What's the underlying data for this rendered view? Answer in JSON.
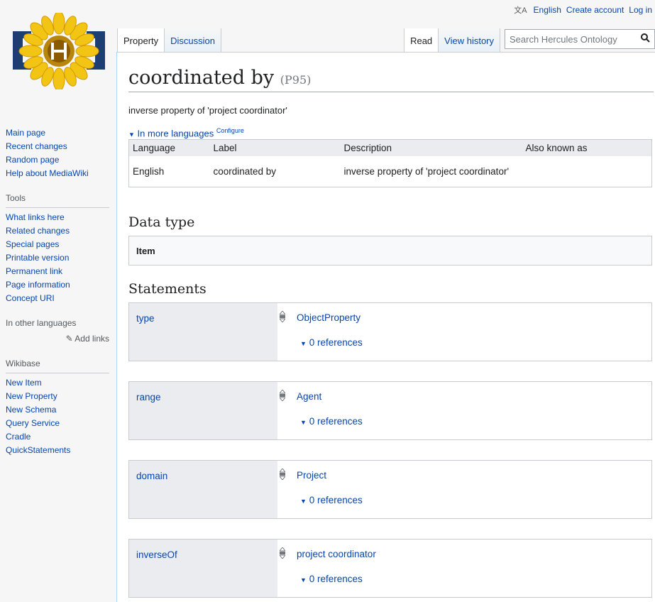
{
  "personal": {
    "language": "English",
    "create_account": "Create account",
    "login": "Log in"
  },
  "sidebar": {
    "navigation": [
      "Main page",
      "Recent changes",
      "Random page",
      "Help about MediaWiki"
    ],
    "tools_heading": "Tools",
    "tools": [
      "What links here",
      "Related changes",
      "Special pages",
      "Printable version",
      "Permanent link",
      "Page information",
      "Concept URI"
    ],
    "languages_heading": "In other languages",
    "add_links": "Add links",
    "wikibase_heading": "Wikibase",
    "wikibase": [
      "New Item",
      "New Property",
      "New Schema",
      "Query Service",
      "Cradle",
      "QuickStatements"
    ]
  },
  "tabs": {
    "property": "Property",
    "discussion": "Discussion",
    "read": "Read",
    "view_history": "View history"
  },
  "search": {
    "placeholder": "Search Hercules Ontology"
  },
  "page": {
    "title": "coordinated by",
    "id": "(P95)",
    "description": "inverse property of 'project coordinator'",
    "more_languages": "In more languages",
    "configure": "Configure"
  },
  "terms_table": {
    "headers": [
      "Language",
      "Label",
      "Description",
      "Also known as"
    ],
    "rows": [
      [
        "English",
        "coordinated by",
        "inverse property of 'project coordinator'",
        ""
      ]
    ]
  },
  "datatype": {
    "heading": "Data type",
    "value": "Item"
  },
  "statements": {
    "heading": "Statements",
    "groups": [
      {
        "property": "type",
        "value": "ObjectProperty",
        "refs": "0 references"
      },
      {
        "property": "range",
        "value": "Agent",
        "refs": "0 references"
      },
      {
        "property": "domain",
        "value": "Project",
        "refs": "0 references"
      },
      {
        "property": "inverseOf",
        "value": "project coordinator",
        "refs": "0 references"
      }
    ]
  },
  "colors": {
    "link": "#0645ad",
    "new_link": "#a55858",
    "border": "#c8ccd1",
    "panel": "#eaecf0"
  }
}
